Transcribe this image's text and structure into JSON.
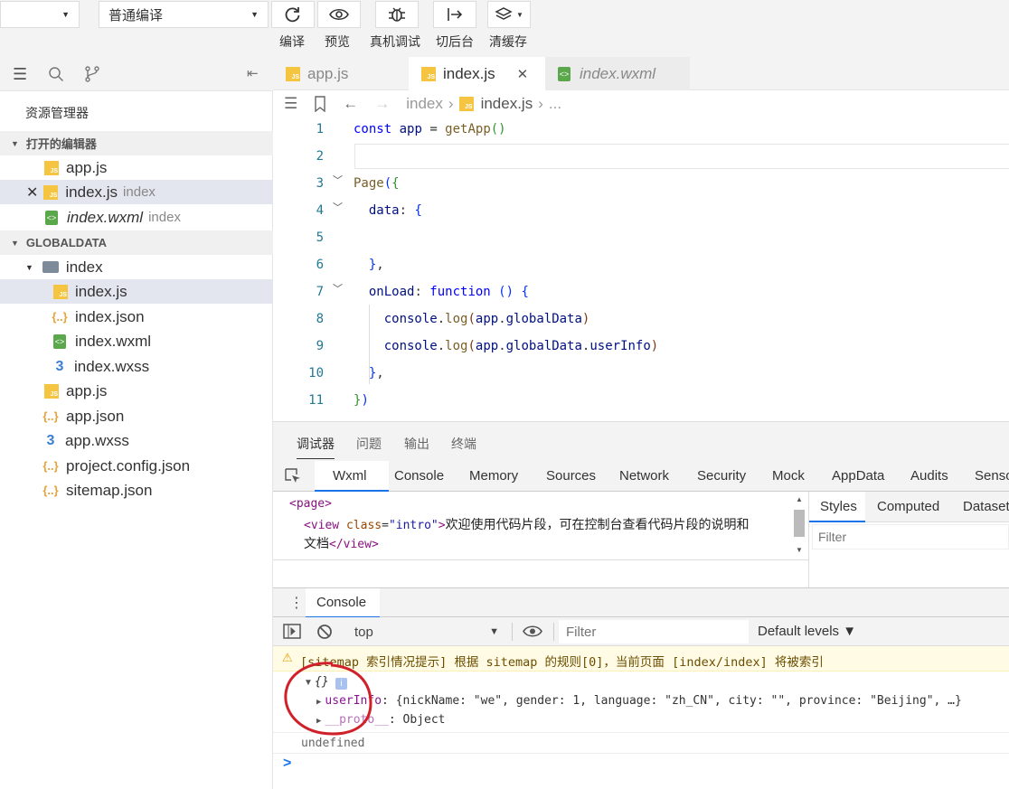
{
  "toolbar": {
    "mode_select": "",
    "compile_select": "普通编译",
    "buttons": [
      {
        "label": "编译",
        "icon": "refresh-icon"
      },
      {
        "label": "预览",
        "icon": "eye-icon"
      },
      {
        "label": "真机调试",
        "icon": "bug-icon"
      },
      {
        "label": "切后台",
        "icon": "switch-background-icon"
      },
      {
        "label": "清缓存",
        "icon": "layers-icon"
      }
    ]
  },
  "sidebar": {
    "title": "资源管理器",
    "open_editors_header": "打开的编辑器",
    "open_editors": [
      {
        "name": "app.js",
        "folder": ""
      },
      {
        "name": "index.js",
        "folder": "index"
      },
      {
        "name": "index.wxml",
        "folder": "index"
      }
    ],
    "project_header": "GLOBALDATA",
    "tree": [
      {
        "name": "index",
        "type": "folder"
      },
      {
        "name": "index.js",
        "type": "js"
      },
      {
        "name": "index.json",
        "type": "json"
      },
      {
        "name": "index.wxml",
        "type": "wxml"
      },
      {
        "name": "index.wxss",
        "type": "wxss"
      },
      {
        "name": "app.js",
        "type": "js"
      },
      {
        "name": "app.json",
        "type": "json"
      },
      {
        "name": "app.wxss",
        "type": "wxss"
      },
      {
        "name": "project.config.json",
        "type": "json"
      },
      {
        "name": "sitemap.json",
        "type": "json"
      }
    ]
  },
  "editor": {
    "tabs": [
      {
        "label": "app.js"
      },
      {
        "label": "index.js"
      },
      {
        "label": "index.wxml"
      }
    ],
    "breadcrumb": [
      "index",
      "index.js",
      "..."
    ],
    "line_numbers": [
      "1",
      "2",
      "3",
      "4",
      "5",
      "6",
      "7",
      "8",
      "9",
      "10",
      "11"
    ]
  },
  "debug_tabs": [
    "调试器",
    "问题",
    "输出",
    "终端"
  ],
  "devtools_tabs": [
    "Wxml",
    "Console",
    "Memory",
    "Sources",
    "Network",
    "Security",
    "Mock",
    "AppData",
    "Audits",
    "Senso"
  ],
  "wxml": {
    "line1": "<page>",
    "line2_tag": "view",
    "line2_attr": "class",
    "line2_val": "\"intro\"",
    "line2_text": "欢迎使用代码片段，可在控制台查看代码片段的说明和",
    "line3_text": "文档",
    "line3_close": "</view>"
  },
  "styles_panel": {
    "tabs": [
      "Styles",
      "Computed",
      "Dataset"
    ],
    "filter_placeholder": "Filter"
  },
  "console": {
    "tab": "Console",
    "context": "top",
    "filter_placeholder": "Filter",
    "levels": "Default levels ▼",
    "warning": "[sitemap 索引情况提示] 根据 sitemap 的规则[0]，当前页面 [index/index] 将被索引",
    "object_label": "{}",
    "userinfo_key": "userInfo",
    "userinfo_value": "{nickName: \"we\", gender: 1, language: \"zh_CN\", city: \"\", province: \"Beijing\", …}",
    "proto_key": "__proto__",
    "proto_value": "Object",
    "undefined": "undefined",
    "prompt": ">"
  },
  "colors": {
    "annotation_circle": "#d0202a",
    "accent": "#1a73e8"
  }
}
